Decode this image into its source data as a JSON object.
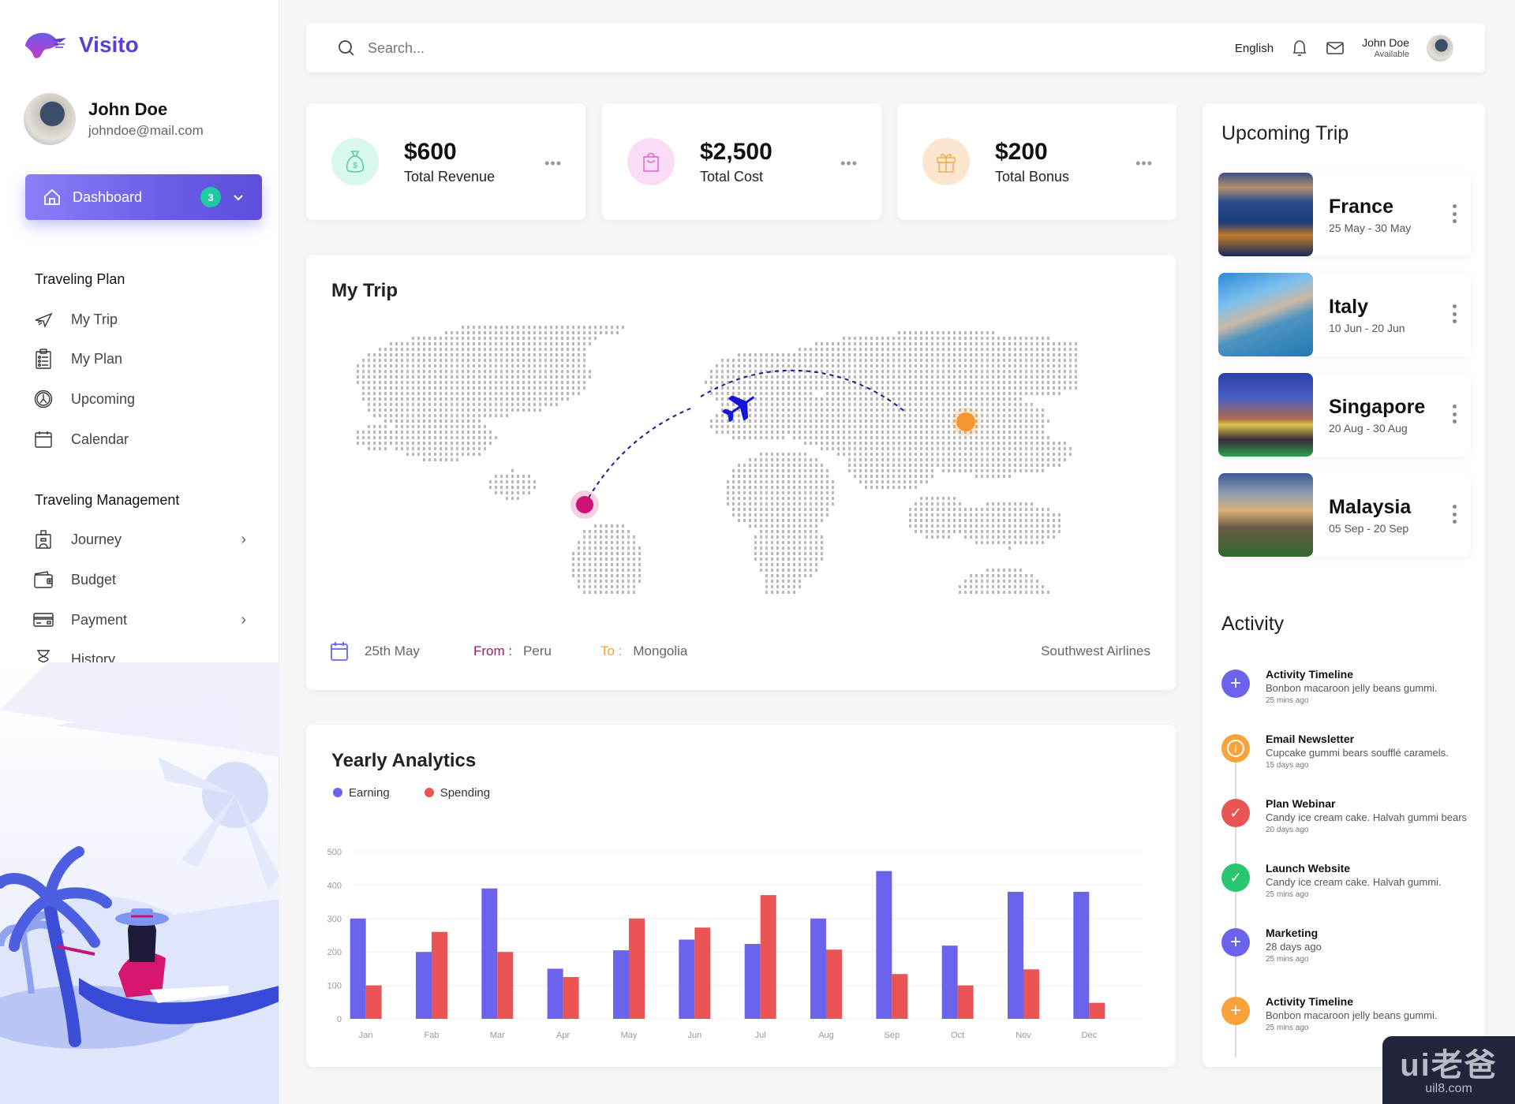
{
  "app": {
    "name": "Visito"
  },
  "user": {
    "name": "John Doe",
    "email": "johndoe@mail.com",
    "status": "Available"
  },
  "sidebar": {
    "dashboard": {
      "label": "Dashboard",
      "badge": "3"
    },
    "sections": [
      {
        "title": "Traveling Plan",
        "items": [
          {
            "label": "My Trip",
            "icon": "airplane-icon"
          },
          {
            "label": "My Plan",
            "icon": "clipboard-icon"
          },
          {
            "label": "Upcoming",
            "icon": "compass-icon"
          },
          {
            "label": "Calendar",
            "icon": "calendar-icon"
          }
        ]
      },
      {
        "title": "Traveling Management",
        "items": [
          {
            "label": "Journey",
            "icon": "luggage-icon",
            "has_submenu": true
          },
          {
            "label": "Budget",
            "icon": "wallet-icon"
          },
          {
            "label": "Payment",
            "icon": "credit-card-icon",
            "has_submenu": true
          },
          {
            "label": "History",
            "icon": "hourglass-icon"
          }
        ]
      }
    ]
  },
  "topbar": {
    "search_placeholder": "Search...",
    "language": "English"
  },
  "stats": [
    {
      "value": "$600",
      "label": "Total Revenue",
      "icon": "money-bag-icon",
      "color": "#3cc79a",
      "bg": "#d8f8ec"
    },
    {
      "value": "$2,500",
      "label": "Total Cost",
      "icon": "shopping-bag-icon",
      "color": "#d94fcf",
      "bg": "#fbdcf7"
    },
    {
      "value": "$200",
      "label": "Total Bonus",
      "icon": "gift-icon",
      "color": "#f0a24a",
      "bg": "#fde6cf"
    }
  ],
  "my_trip": {
    "title": "My Trip",
    "date": "25th May",
    "from_label": "From :",
    "from": "Peru",
    "to_label": "To :",
    "to": "Mongolia",
    "airline": "Southwest Airlines",
    "origin_color": "#cc1277",
    "destination_color": "#f7962f",
    "route_color": "#1b1b8f"
  },
  "analytics": {
    "title": "Yearly Analytics"
  },
  "chart_data": {
    "type": "bar",
    "title": "Yearly Analytics",
    "xlabel": "",
    "ylabel": "",
    "ylim": [
      0,
      500
    ],
    "yticks": [
      0,
      100,
      200,
      300,
      400,
      500
    ],
    "grid": true,
    "legend": "top-left",
    "categories": [
      "Jan",
      "Fab",
      "Mar",
      "Apr",
      "May",
      "Jun",
      "Jul",
      "Aug",
      "Sep",
      "Oct",
      "Nov",
      "Dec"
    ],
    "series": [
      {
        "name": "Earning",
        "color": "#6c63ed",
        "values": [
          300,
          200,
          390,
          150,
          205,
          237,
          224,
          300,
          442,
          219,
          380,
          380
        ]
      },
      {
        "name": "Spending",
        "color": "#ea5455",
        "values": [
          100,
          260,
          200,
          125,
          300,
          273,
          370,
          207,
          134,
          100,
          148,
          48
        ]
      }
    ]
  },
  "upcoming": {
    "title": "Upcoming Trip",
    "trips": [
      {
        "name": "France",
        "dates": "25 May - 30 May"
      },
      {
        "name": "Italy",
        "dates": "10 Jun - 20 Jun"
      },
      {
        "name": "Singapore",
        "dates": "20 Aug - 30 Aug"
      },
      {
        "name": "Malaysia",
        "dates": "05 Sep - 20 Sep"
      }
    ]
  },
  "activity": {
    "title": "Activity",
    "items": [
      {
        "title": "Activity Timeline",
        "desc": "Bonbon macaroon jelly beans gummi.",
        "ago": "25 mins ago",
        "icon": "plus-icon",
        "color": "#6c63ed"
      },
      {
        "title": "Email Newsletter",
        "desc": "Cupcake gummi bears soufflé caramels.",
        "ago": "15 days ago",
        "icon": "info-icon",
        "color": "#f7a23b"
      },
      {
        "title": "Plan Webinar",
        "desc": "Candy ice cream cake. Halvah gummi bears",
        "ago": "20 days ago",
        "icon": "check-icon",
        "color": "#ea5455"
      },
      {
        "title": "Launch Website",
        "desc": "Candy ice cream cake. Halvah gummi.",
        "ago": "25 mins ago",
        "icon": "check-icon",
        "color": "#28c76f"
      },
      {
        "title": "Marketing",
        "desc": "28 days ago",
        "ago": "25 mins ago",
        "icon": "plus-icon",
        "color": "#6c63ed"
      },
      {
        "title": "Activity Timeline",
        "desc": "Bonbon macaroon jelly beans gummi.",
        "ago": "25 mins ago",
        "icon": "plus-icon",
        "color": "#f7a23b"
      }
    ]
  },
  "watermark": {
    "big": "ui老爸",
    "small": "uil8.com"
  }
}
